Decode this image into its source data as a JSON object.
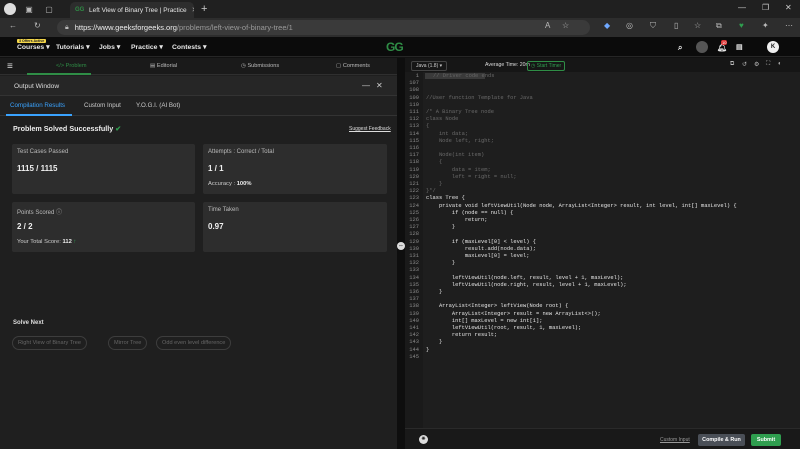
{
  "browser": {
    "tab_title": "Left View of Binary Tree | Practice",
    "url_host": "https://www.geeksforgeeks.org",
    "url_path": "/problems/left-view-of-binary-tree/1"
  },
  "site": {
    "offer_badge": "3 Offers Active",
    "nav": [
      "Courses",
      "Tutorials",
      "Jobs",
      "Practice",
      "Contests"
    ],
    "logo": "GG",
    "notif_count": "10",
    "avatar_letter": "K"
  },
  "problem_tabs": [
    "Problem",
    "Editorial",
    "Submissions",
    "Comments"
  ],
  "output_window": {
    "title": "Output Window",
    "tabs": [
      "Compilation Results",
      "Custom Input",
      "Y.O.G.I. (AI Bot)"
    ],
    "status": "Problem Solved Successfully",
    "suggest_feedback": "Suggest Feedback",
    "test_cases_label": "Test Cases Passed",
    "test_cases_value": "1115 / 1115",
    "attempts_label": "Attempts : Correct / Total",
    "attempts_value": "1 / 1",
    "accuracy_label": "Accuracy :",
    "accuracy_value": "100%",
    "points_label": "Points Scored",
    "points_value": "2 / 2",
    "total_score_label": "Your Total Score:",
    "total_score_value": "112",
    "time_label": "Time Taken",
    "time_value": "0.97",
    "solve_next_label": "Solve Next",
    "solve_next": [
      "Right View of Binary Tree",
      "Mirror Tree",
      "Odd even level difference"
    ]
  },
  "editor": {
    "language": "Java (1.8)",
    "avg_time_label": "Average Time: 20m",
    "start_timer": "Start Timer",
    "lines": [
      {
        "n": "1",
        "code": "// Driver code ends"
      },
      {
        "n": "107",
        "code": ""
      },
      {
        "n": "108",
        "code": ""
      },
      {
        "n": "109",
        "code": "//User function Template for Java"
      },
      {
        "n": "110",
        "code": ""
      },
      {
        "n": "111",
        "code": "/* A Binary Tree node"
      },
      {
        "n": "112",
        "code": "class Node"
      },
      {
        "n": "113",
        "code": "{"
      },
      {
        "n": "114",
        "code": "    int data;"
      },
      {
        "n": "115",
        "code": "    Node left, right;"
      },
      {
        "n": "116",
        "code": ""
      },
      {
        "n": "117",
        "code": "    Node(int item)"
      },
      {
        "n": "118",
        "code": "    {"
      },
      {
        "n": "119",
        "code": "        data = item;"
      },
      {
        "n": "120",
        "code": "        left = right = null;"
      },
      {
        "n": "121",
        "code": "    }"
      },
      {
        "n": "122",
        "code": "}*/"
      },
      {
        "n": "123",
        "code": "class Tree {"
      },
      {
        "n": "124",
        "code": "    private void leftViewUtil(Node node, ArrayList<Integer> result, int level, int[] maxLevel) {"
      },
      {
        "n": "125",
        "code": "        if (node == null) {"
      },
      {
        "n": "126",
        "code": "            return;"
      },
      {
        "n": "127",
        "code": "        }"
      },
      {
        "n": "128",
        "code": ""
      },
      {
        "n": "129",
        "code": "        if (maxLevel[0] < level) {"
      },
      {
        "n": "130",
        "code": "            result.add(node.data);"
      },
      {
        "n": "131",
        "code": "            maxLevel[0] = level;"
      },
      {
        "n": "132",
        "code": "        }"
      },
      {
        "n": "133",
        "code": ""
      },
      {
        "n": "134",
        "code": "        leftViewUtil(node.left, result, level + 1, maxLevel);"
      },
      {
        "n": "135",
        "code": "        leftViewUtil(node.right, result, level + 1, maxLevel);"
      },
      {
        "n": "136",
        "code": "    }"
      },
      {
        "n": "137",
        "code": ""
      },
      {
        "n": "138",
        "code": "    ArrayList<Integer> leftView(Node root) {"
      },
      {
        "n": "139",
        "code": "        ArrayList<Integer> result = new ArrayList<>();"
      },
      {
        "n": "140",
        "code": "        int[] maxLevel = new int[1];"
      },
      {
        "n": "141",
        "code": "        leftViewUtil(root, result, 1, maxLevel);"
      },
      {
        "n": "142",
        "code": "        return result;"
      },
      {
        "n": "143",
        "code": "    }"
      },
      {
        "n": "144",
        "code": "}"
      },
      {
        "n": "145",
        "code": ""
      }
    ]
  },
  "actions": {
    "custom_input": "Custom Input",
    "compile_run": "Compile & Run",
    "submit": "Submit"
  },
  "colors": {
    "accent_green": "#2f8d46",
    "accent_blue": "#3aa3ff",
    "submit_green": "#2f9e4f"
  }
}
